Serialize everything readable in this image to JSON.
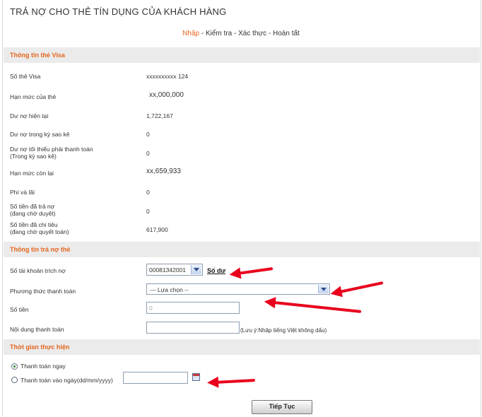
{
  "title": "TRẢ NỢ CHO THẺ TÍN DỤNG CỦA KHÁCH HÀNG",
  "steps": {
    "current": "Nhập",
    "rest": " - Kiểm tra - Xác thực - Hoàn tất"
  },
  "card_section": {
    "heading": "Thông tin thẻ Visa",
    "rows": [
      {
        "label1": "Số thẻ Visa",
        "label2": "",
        "value": "xxxxxxxxxx  124"
      },
      {
        "label1": "Hạn mức của thẻ",
        "label2": "",
        "value": "xx,000,000"
      },
      {
        "label1": "Dư nợ hiện tại",
        "label2": "",
        "value": "1,722,167"
      },
      {
        "label1": "Dư nợ trong kỳ sao kê",
        "label2": "",
        "value": "0"
      },
      {
        "label1": "Dư nợ tối thiểu phải thanh toán",
        "label2": "(Trong kỳ sao kê)",
        "value": "0"
      },
      {
        "label1": "Hạn mức còn lại",
        "label2": "",
        "value": "xx,659,933"
      },
      {
        "label1": "Phí và lãi",
        "label2": "",
        "value": "0"
      },
      {
        "label1": "Số tiền đã trả nợ",
        "label2": "(đang chờ duyệt)",
        "value": "0"
      },
      {
        "label1": "Số tiền đã chi tiêu",
        "label2": "(đang chờ quyết toán)",
        "value": "617,900"
      }
    ]
  },
  "payment_section": {
    "heading": "Thông tin trả nợ thẻ",
    "account_label": "Số tài khoản trích nợ",
    "account_value": "00081342001",
    "balance_link": "Số dư",
    "method_label": "Phương thức thanh toán",
    "method_value": "--- Lựa chọn --",
    "amount_label": "Số tiền",
    "amount_placeholder": "0",
    "content_label": "Nội dung thanh toán",
    "content_value": "",
    "content_note": "(Lưu ý:Nhập tiếng Việt không dấu)"
  },
  "time_section": {
    "heading": "Thời gian thực hiện",
    "pay_now": "Thanh toán ngay",
    "pay_on_date": "Thanh toán vào ngày(dd/mm/yyyy)",
    "date_value": ""
  },
  "continue_button": "Tiếp Tục",
  "colors": {
    "accent": "#e5661e",
    "arrow": "#e8001c",
    "section_bg": "#ebebeb"
  }
}
